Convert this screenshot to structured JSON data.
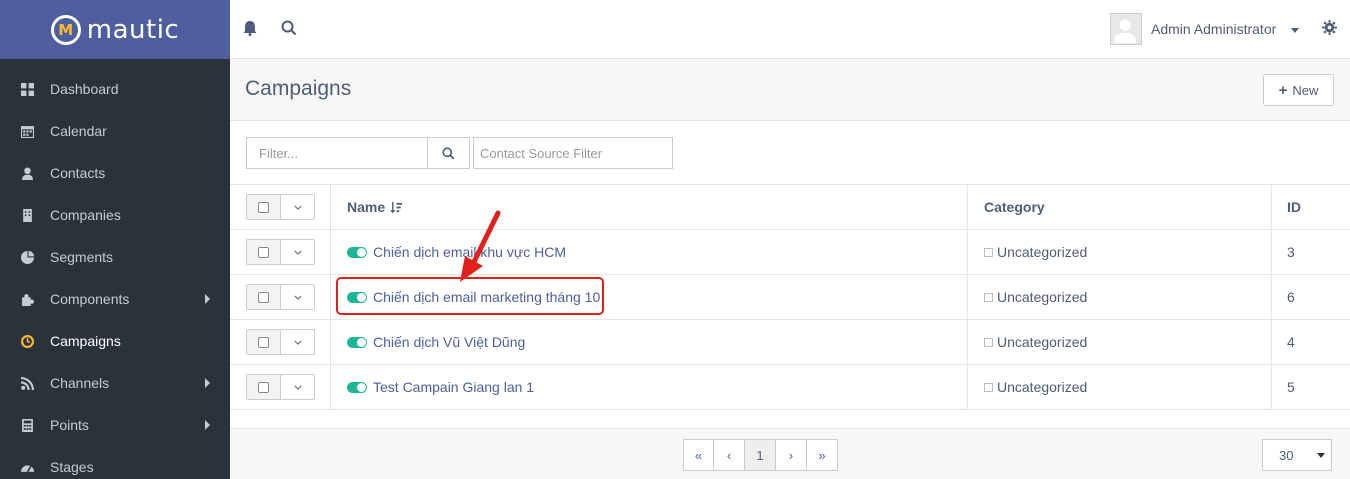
{
  "brand": {
    "name": "mautic",
    "logo_letter": "M"
  },
  "colors": {
    "sidebar_bg": "#2a323c",
    "brand_bg": "#4e5e9e",
    "toggle_on": "#1fb597",
    "highlight": "#e0201a",
    "active_icon": "#fdb933"
  },
  "sidebar": {
    "items": [
      {
        "label": "Dashboard",
        "icon": "grid-icon",
        "submenu": false
      },
      {
        "label": "Calendar",
        "icon": "calendar-icon",
        "submenu": false
      },
      {
        "label": "Contacts",
        "icon": "user-icon",
        "submenu": false
      },
      {
        "label": "Companies",
        "icon": "building-icon",
        "submenu": false
      },
      {
        "label": "Segments",
        "icon": "pie-chart-icon",
        "submenu": false
      },
      {
        "label": "Components",
        "icon": "puzzle-icon",
        "submenu": true
      },
      {
        "label": "Campaigns",
        "icon": "clock-icon",
        "submenu": false,
        "active": true
      },
      {
        "label": "Channels",
        "icon": "rss-icon",
        "submenu": true
      },
      {
        "label": "Points",
        "icon": "calculator-icon",
        "submenu": true
      },
      {
        "label": "Stages",
        "icon": "tachometer-icon",
        "submenu": false
      }
    ]
  },
  "topbar": {
    "user_name": "Admin Administrator"
  },
  "page": {
    "title": "Campaigns",
    "new_label": "New"
  },
  "filters": {
    "filter_placeholder": "Filter...",
    "source_placeholder": "Contact Source Filter"
  },
  "table": {
    "headers": {
      "name": "Name",
      "category": "Category",
      "id": "ID"
    },
    "rows": [
      {
        "name": "Chiến dịch email khu vực HCM",
        "category": "Uncategorized",
        "id": "3"
      },
      {
        "name": "Chiến dịch email marketing tháng 10",
        "category": "Uncategorized",
        "id": "6"
      },
      {
        "name": "Chiến dịch Vũ Việt Dũng",
        "category": "Uncategorized",
        "id": "4"
      },
      {
        "name": "Test Campain Giang lan 1",
        "category": "Uncategorized",
        "id": "5"
      }
    ]
  },
  "pagination": {
    "current_page": "1",
    "per_page": "30"
  }
}
